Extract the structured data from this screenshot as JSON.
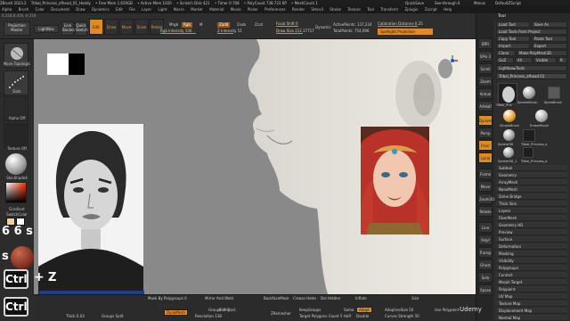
{
  "titlebar": {
    "items": [
      "ZBrush 2023.2",
      "Tribal_Princess_afhead_01_Hoddy",
      "• Free Mem 1.620GB",
      "• Active Mem 1020",
      "• Scratch Disk 421",
      "• Timer 0.708",
      "• PolyCount 738.723 KP",
      "• MeshCount 1"
    ],
    "right": [
      "QuickSave",
      "See-through 0",
      "Menus",
      "DefaultZScript"
    ]
  },
  "menubar": {
    "items": [
      "Alpha",
      "Brush",
      "Color",
      "Document",
      "Draw",
      "Dynamics",
      "Edit",
      "File",
      "Layer",
      "Light",
      "Macro",
      "Marker",
      "Material",
      "Movie",
      "Picker",
      "Preferences",
      "Render",
      "Stencil",
      "Stroke",
      "Texture",
      "Tool",
      "Transform",
      "Zplugin",
      "Zscript",
      "Help"
    ],
    "coords": "0.218,0.416,-0.219"
  },
  "shelf": {
    "projection_master": "Projection Master",
    "lightbox": "LightBox",
    "live_boolean": "Live Boolean",
    "quick_sketch": "Quick Sketch",
    "edit": "Edit",
    "draw": "Draw",
    "move": "Move",
    "scale": "Scale",
    "rotate": "Rotate",
    "mrgb": "Mrgb",
    "rgb": "Rgb",
    "m": "M",
    "rgb_intensity": "Rgb Intensity 100",
    "zadd": "Zadd",
    "zsub": "Zsub",
    "z_intensity": "Z Intensity 51",
    "zcut": "Zcut",
    "focal_shift": "Focal Shift 0",
    "draw_size": "Draw Size 212.17717",
    "dynamic": "Dynamic",
    "active_points": "ActivePoints: 137,224",
    "total_points": "TotalPoints: 754,096",
    "calibration_distance": "Calibration Distance 0.25",
    "spotlight_projection": "Spotlight Projection"
  },
  "leftpanel": {
    "brush_label": "Move Topologic",
    "stroke_label": "Dots",
    "alpha_label": "Alpha Off",
    "texture_label": "Texture Off",
    "material_label": "SkinShade4",
    "gradient_label": "Gradient",
    "switch_color_label": "SwitchColor",
    "alternate_label": "Alternate"
  },
  "overlay": {
    "key1": "6",
    "key2": "6",
    "key3": "s",
    "ctrl1": "Ctrl",
    "ctrl2": "Ctrl",
    "plus": "+",
    "z": "Z",
    "watermark": "Udemy"
  },
  "rightshelf": {
    "buttons": [
      "BPR",
      "SPix 3",
      "Scroll",
      "Zoom",
      "Actual",
      "AAHalf",
      "Dynamic",
      "Persp",
      "Floor",
      "Local",
      "Frame",
      "Move",
      "Zoom3D",
      "Rotate",
      "Line Fill",
      "Polyf",
      "Transp",
      "Ghost",
      "Solo",
      "Xpose"
    ]
  },
  "toolpanel": {
    "title": "Tool",
    "load_tool": "Load Tool",
    "save_as": "Save As",
    "copy_tool": "Copy Tool",
    "paste_tool": "Paste Tool",
    "load_tools_from_project": "Load Tools From Project",
    "import": "Import",
    "export": "Export",
    "clone": "Clone",
    "make_polymesh": "Make PolyMesh3D",
    "goz": "GoZ",
    "all": "All",
    "visible": "Visible",
    "r": "R",
    "lightbox_tools": "Lightbox▸Tools",
    "current_tool": "Tribal_Princess_afhead 01",
    "count": "R",
    "thumbs": [
      "Tribal_Prin",
      "SphereBrush",
      "AlphaBrush",
      "SimpleBrush",
      "EraserBrush",
      "Sphere3D",
      "Tribal_Princess_a",
      "Sphere3D_1",
      "Tribal_Princess_a"
    ],
    "menus": [
      "Subtool",
      "Geometry",
      "ArrayMesh",
      "NanoMesh",
      "Slime Bridge",
      "Thick Skin",
      "Layers",
      "FiberMesh",
      "Geometry HD",
      "Preview",
      "Surface",
      "Deformation",
      "Masking",
      "Visibility",
      "Polygroups",
      "Contact",
      "Morph Target",
      "Polypaint",
      "UV Map",
      "Texture Map",
      "Displacement Map",
      "Normal Map",
      "Vector Displacement Map",
      "Display Properties"
    ]
  },
  "bottombar": {
    "mask_by_polygroups": "Mask By Polygroups 0",
    "mirror_and_weld": "Mirror And Weld",
    "backface_mask": "BackfaceMask",
    "crease": "Crease Holes",
    "del_hidden": "Del Hidden",
    "inflate": "Inflate",
    "size": "Size",
    "thick": "Thick 0.03",
    "groups_split": "Groups Split",
    "dynamesh": "DynaMesh",
    "groups": "Groups",
    "blur": "Blur 2",
    "project": "Project",
    "resolution": "Resolution 128",
    "zremesher": "ZRemesher",
    "keep_groups": "KeepGroups",
    "target_polygons": "Target Polygons Count 5",
    "same": "Same",
    "adapt": "Adapt",
    "half": "Half",
    "double": "Double",
    "adaptive_size": "AdaptiveSize 50",
    "curves_strength": "Curves Strength 50",
    "use_polypaint": "Use Polypaint"
  }
}
